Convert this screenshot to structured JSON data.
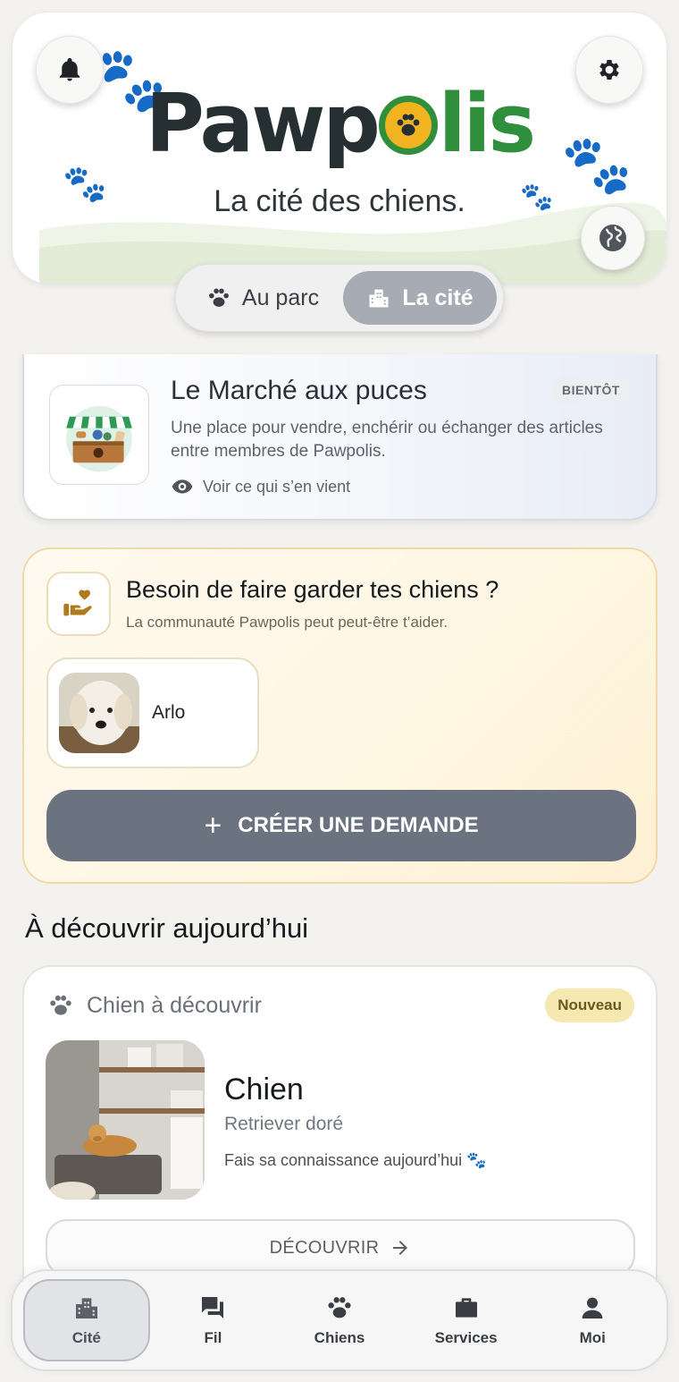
{
  "header": {
    "logo_part1": "Pawp",
    "logo_part2": "lis",
    "tagline": "La cité des chiens."
  },
  "mode_toggle": {
    "options": [
      {
        "label": "Au parc",
        "icon": "paw-icon",
        "selected": false
      },
      {
        "label": "La cité",
        "icon": "city-icon",
        "selected": true
      }
    ]
  },
  "market": {
    "title": "Le Marché aux puces",
    "badge": "BIENTÔT",
    "description": "Une place pour vendre, enchérir ou échanger des articles entre membres de Pawpolis.",
    "link": "Voir ce qui s’en vient"
  },
  "dog_sitting": {
    "title": "Besoin de faire garder tes chiens ?",
    "subtitle": "La communauté Pawpolis peut peut-être t’aider.",
    "dogs": [
      {
        "name": "Arlo"
      }
    ],
    "create_button": "CRÉER UNE DEMANDE"
  },
  "discover": {
    "section_title": "À découvrir aujourd’hui",
    "card_header": "Chien à découvrir",
    "badge": "Nouveau",
    "dog_name": "Chien",
    "breed": "Retriever doré",
    "meet_text": "Fais sa connaissance aujourd’hui 🐾",
    "button": "DÉCOUVRIR"
  },
  "bottom_nav": {
    "items": [
      {
        "label": "Cité",
        "icon": "city-icon",
        "active": true
      },
      {
        "label": "Fil",
        "icon": "chat-icon",
        "active": false
      },
      {
        "label": "Chiens",
        "icon": "paw-icon",
        "active": false
      },
      {
        "label": "Services",
        "icon": "briefcase-icon",
        "active": false
      },
      {
        "label": "Moi",
        "icon": "person-icon",
        "active": false
      }
    ]
  },
  "colors": {
    "brand_green": "#2f8f3c",
    "brand_yellow": "#f2b320",
    "primary_button": "#6b7280",
    "sitting_border": "#f0d9a4",
    "new_badge": "#f6e8b1"
  }
}
